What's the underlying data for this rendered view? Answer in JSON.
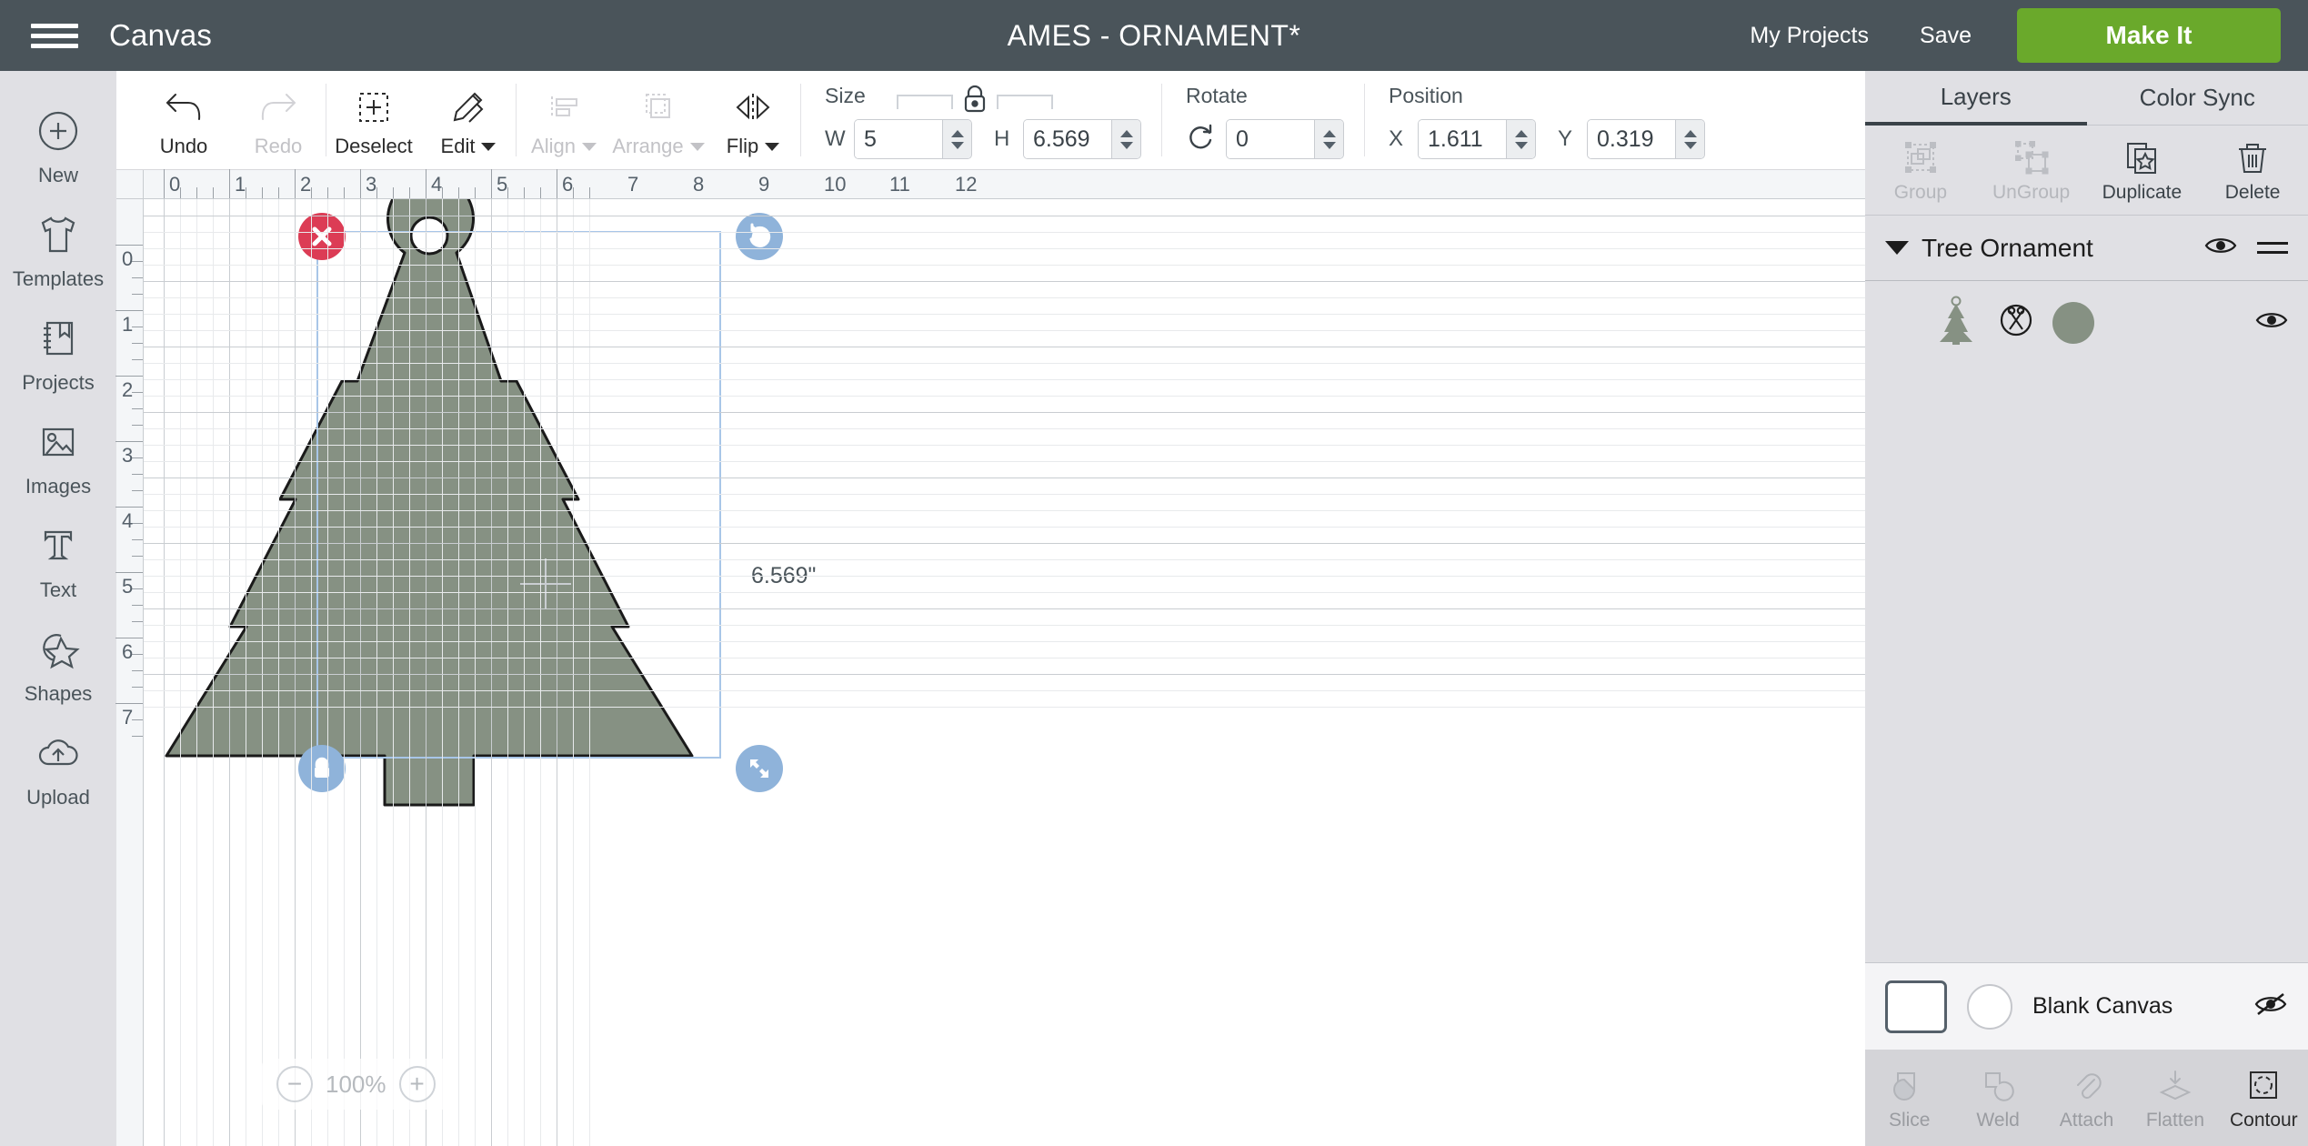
{
  "header": {
    "menu_icon": "hamburger-icon",
    "canvas_label": "Canvas",
    "document_title": "AMES - ORNAMENT*",
    "my_projects": "My Projects",
    "save": "Save",
    "make_it": "Make It",
    "bg_color": "#4a545a",
    "make_it_color": "#6aa92b"
  },
  "left_rail": {
    "items": [
      {
        "label": "New",
        "icon": "plus-circle-icon"
      },
      {
        "label": "Templates",
        "icon": "tshirt-icon"
      },
      {
        "label": "Projects",
        "icon": "bookmark-book-icon"
      },
      {
        "label": "Images",
        "icon": "photo-icon"
      },
      {
        "label": "Text",
        "icon": "text-t-icon"
      },
      {
        "label": "Shapes",
        "icon": "star-circle-icon"
      },
      {
        "label": "Upload",
        "icon": "cloud-upload-icon"
      }
    ]
  },
  "toolbar": {
    "history": [
      {
        "label": "Undo",
        "icon": "undo-arrow-icon",
        "disabled": false
      },
      {
        "label": "Redo",
        "icon": "redo-arrow-icon",
        "disabled": true
      }
    ],
    "edit_group": [
      {
        "label": "Deselect",
        "icon": "dashed-box-plus-icon",
        "disabled": false,
        "caret": false
      },
      {
        "label": "Edit",
        "icon": "pencil-ruler-icon",
        "disabled": false,
        "caret": true
      }
    ],
    "arrange_group": [
      {
        "label": "Align",
        "icon": "align-left-icon",
        "disabled": true,
        "caret": true
      },
      {
        "label": "Arrange",
        "icon": "layers-stack-icon",
        "disabled": true,
        "caret": true
      },
      {
        "label": "Flip",
        "icon": "flip-horizontal-icon",
        "disabled": false,
        "caret": true
      }
    ],
    "size": {
      "title": "Size",
      "lock_icon": "lock-closed-icon",
      "width_key": "W",
      "width_value": "5",
      "height_key": "H",
      "height_value": "6.569"
    },
    "rotate": {
      "title": "Rotate",
      "icon": "rotate-cw-icon",
      "value": "0"
    },
    "position": {
      "title": "Position",
      "x_key": "X",
      "x_value": "1.611",
      "y_key": "Y",
      "y_value": "0.319"
    }
  },
  "canvas": {
    "ruler_top": [
      "0",
      "1",
      "2",
      "3",
      "4",
      "5",
      "6",
      "7",
      "8",
      "9",
      "10",
      "11",
      "12"
    ],
    "ruler_left": [
      "0",
      "1",
      "2",
      "3",
      "4",
      "5",
      "6",
      "7"
    ],
    "zoom_level": "100%",
    "zoom_out_icon": "minus-circle-icon",
    "zoom_in_icon": "plus-circle-icon",
    "dimension_label": "6.569\"",
    "shape": {
      "name": "tree-ornament-shape",
      "fill": "#869183",
      "stroke": "#1a1a1a"
    },
    "selection": {
      "border_color": "#a8c6e8",
      "handles": [
        {
          "name": "delete-handle",
          "icon": "x-icon",
          "color": "#dc3c55"
        },
        {
          "name": "rotate-handle",
          "icon": "rotate-ccw-icon",
          "color": "#8fb3da"
        },
        {
          "name": "lock-aspect-handle",
          "icon": "lock-closed-icon",
          "color": "#8fb3da"
        },
        {
          "name": "resize-handle",
          "icon": "diagonal-arrows-icon",
          "color": "#8fb3da"
        }
      ]
    }
  },
  "right_panel": {
    "tabs": [
      {
        "label": "Layers",
        "active": true
      },
      {
        "label": "Color Sync",
        "active": false
      }
    ],
    "actions": [
      {
        "label": "Group",
        "icon": "group-icon",
        "disabled": true
      },
      {
        "label": "UnGroup",
        "icon": "ungroup-icon",
        "disabled": true
      },
      {
        "label": "Duplicate",
        "icon": "duplicate-icon",
        "disabled": false
      },
      {
        "label": "Delete",
        "icon": "trash-icon",
        "disabled": false
      }
    ],
    "layer_group": {
      "name": "Tree Ornament",
      "expanded": true,
      "visibility_icon": "eye-icon",
      "menu_icon": "hamburger-small-icon"
    },
    "layer_rows": [
      {
        "thumbnail_icon": "tree-thumbnail-icon",
        "operation_icon": "cut-scissors-icon",
        "swatch_color": "#869183",
        "visibility_icon": "eye-icon"
      }
    ],
    "canvas_layer": {
      "label": "Blank Canvas",
      "swatch_color": "#ffffff",
      "visibility_icon": "eye-off-icon"
    },
    "bottom_tools": [
      {
        "label": "Slice",
        "icon": "slice-icon",
        "disabled": true
      },
      {
        "label": "Weld",
        "icon": "weld-icon",
        "disabled": true
      },
      {
        "label": "Attach",
        "icon": "paperclip-icon",
        "disabled": true
      },
      {
        "label": "Flatten",
        "icon": "flatten-icon",
        "disabled": true
      },
      {
        "label": "Contour",
        "icon": "contour-icon",
        "disabled": false
      }
    ]
  }
}
